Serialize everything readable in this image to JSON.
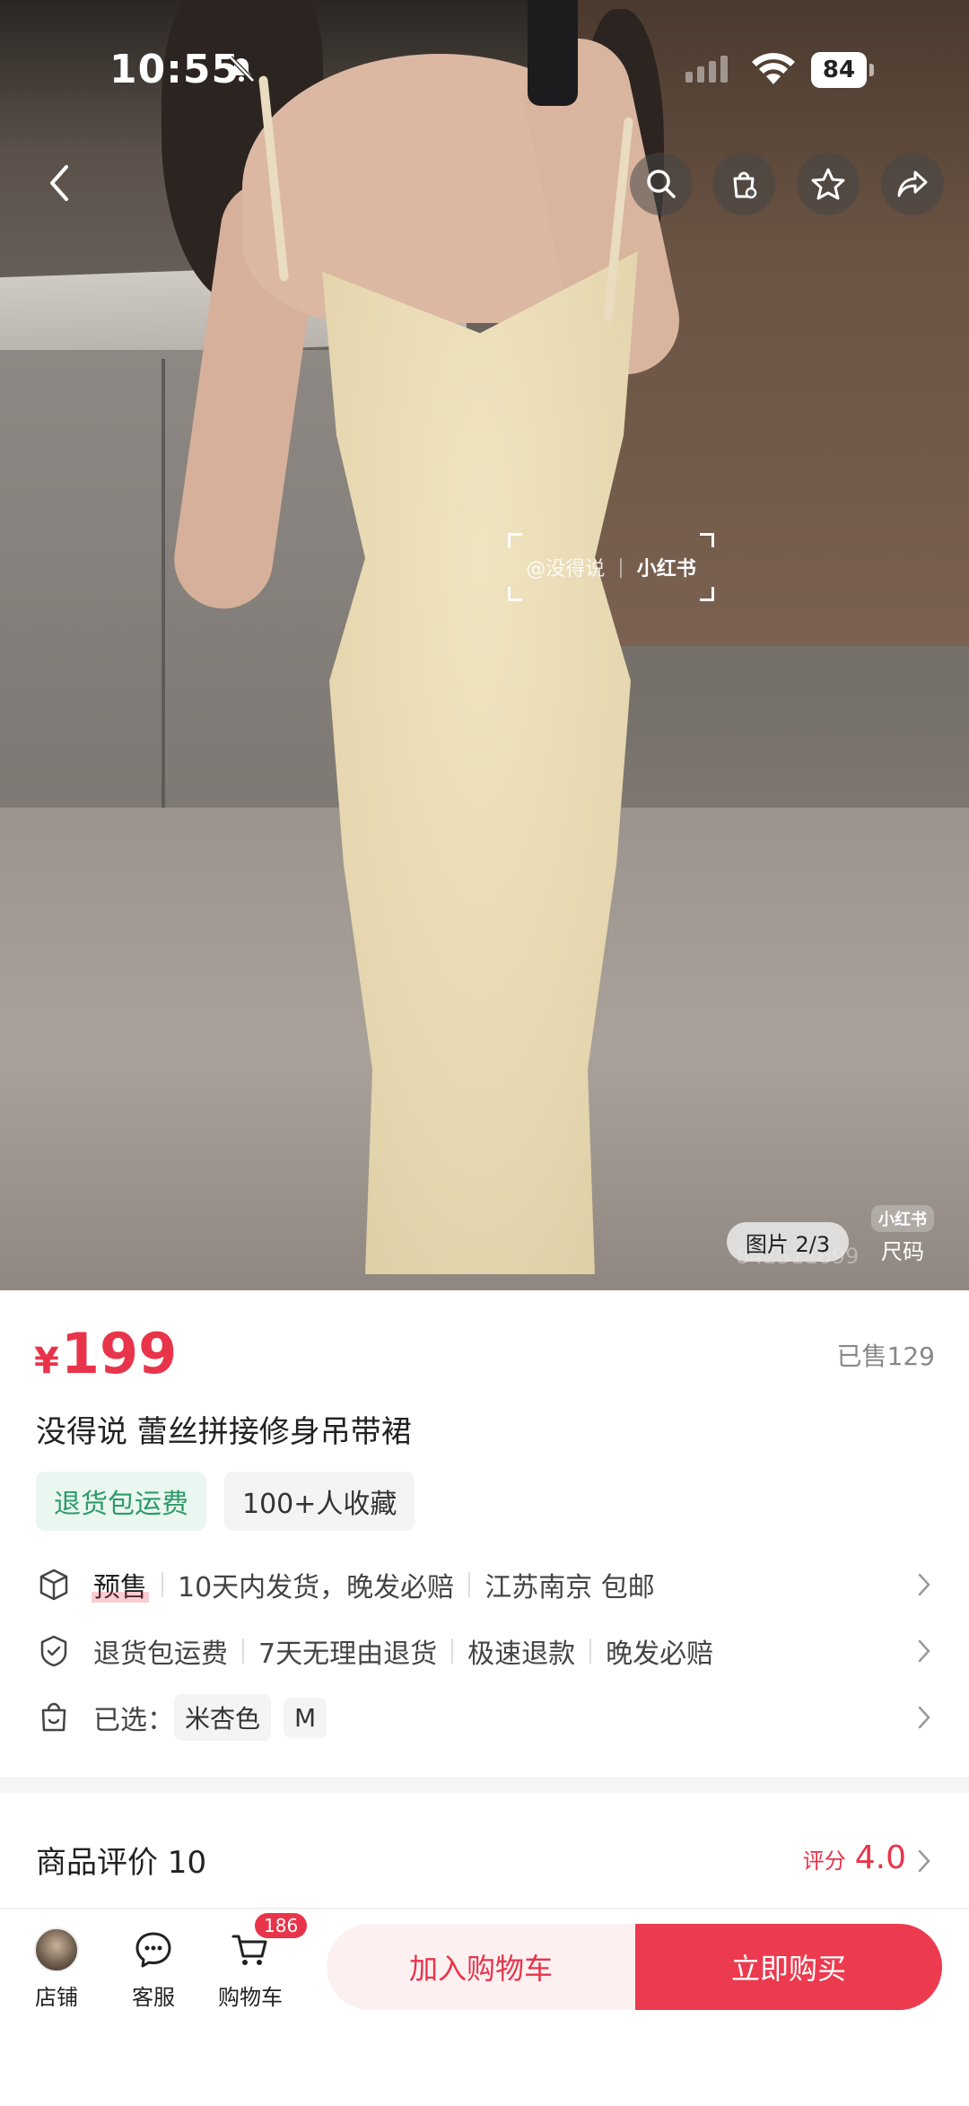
{
  "status_bar": {
    "time": "10:55",
    "battery": "84"
  },
  "gallery": {
    "watermark_user": "@没得说",
    "watermark_brand": "小红书",
    "image_counter": "图片 2/3",
    "size_badge_brand": "小红书",
    "size_badge_label": "尺码",
    "faint_id": "842511699",
    "current_image": 2,
    "total_images": 3
  },
  "product": {
    "currency": "¥",
    "price": "199",
    "sold": "已售129",
    "title": "没得说 蕾丝拼接修身吊带裙",
    "tags": [
      "退货包运费",
      "100+人收藏"
    ]
  },
  "shipping_row": {
    "badge": "预售",
    "items": [
      "10天内发货，晚发必赔",
      "江苏南京 包邮"
    ]
  },
  "service_row": {
    "items": [
      "退货包运费",
      "7天无理由退货",
      "极速退款",
      "晚发必赔"
    ]
  },
  "selection_row": {
    "label": "已选：",
    "options": [
      "米杏色",
      "M"
    ]
  },
  "reviews": {
    "title": "商品评价 10",
    "score_label": "评分",
    "score": "4.0"
  },
  "bottom_bar": {
    "store": "店铺",
    "service": "客服",
    "cart": "购物车",
    "cart_count": "186",
    "add_to_cart": "加入购物车",
    "buy_now": "立即购买"
  },
  "colors": {
    "accent": "#e8344a",
    "green": "#2e9a68"
  }
}
